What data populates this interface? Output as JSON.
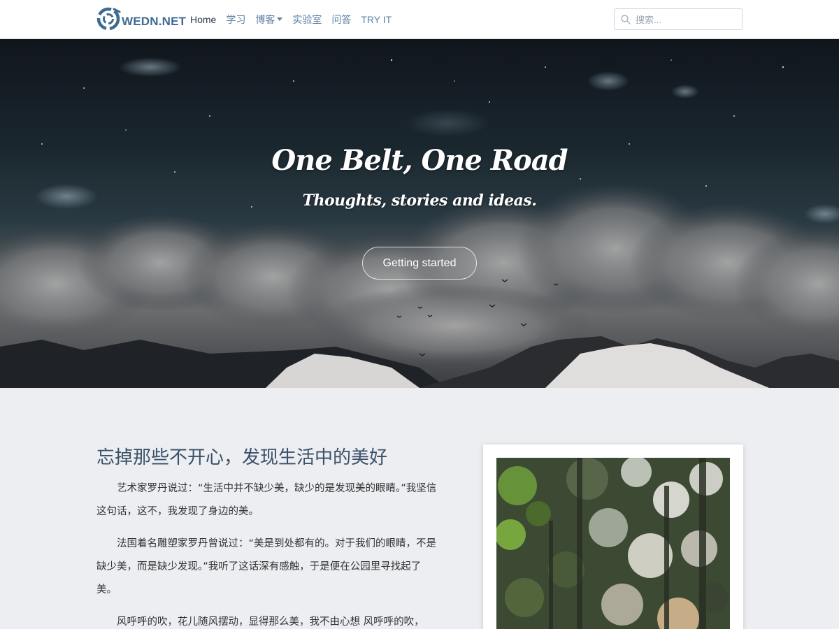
{
  "brand": {
    "name": "WEDN.NET"
  },
  "nav": {
    "items": [
      {
        "label": "Home",
        "active": true
      },
      {
        "label": "学习"
      },
      {
        "label": "博客",
        "dropdown": true
      },
      {
        "label": "实验室"
      },
      {
        "label": "问答"
      },
      {
        "label": "TRY IT"
      }
    ]
  },
  "search": {
    "placeholder": "搜索..."
  },
  "hero": {
    "title": "One Belt, One Road",
    "subtitle": "Thoughts, stories and ideas.",
    "button": "Getting started"
  },
  "article": {
    "title": "忘掉那些不开心，发现生活中的美好",
    "paragraphs": [
      "艺术家罗丹说过：“生活中并不缺少美，缺少的是发现美的眼睛。”我坚信这句话，这不，我发现了身边的美。",
      "法国着名雕塑家罗丹曾说过：“美是到处都有的。对于我们的眼睛，不是缺少美，而是缺少发现。”我听了这话深有感触，于是便在公园里寻找起了美。",
      "风呼呼的吹，花儿随风摆动，显得那么美，我不由心想 风呼呼的吹，"
    ]
  },
  "colors": {
    "brand": "#3f6a92",
    "nav_link": "#5d7fa3",
    "page_bg": "#eceef2",
    "title": "#3a5068"
  },
  "icons": {
    "search": "search-icon",
    "logo": "wedn-logo-icon",
    "dropdown": "caret-down-icon"
  }
}
